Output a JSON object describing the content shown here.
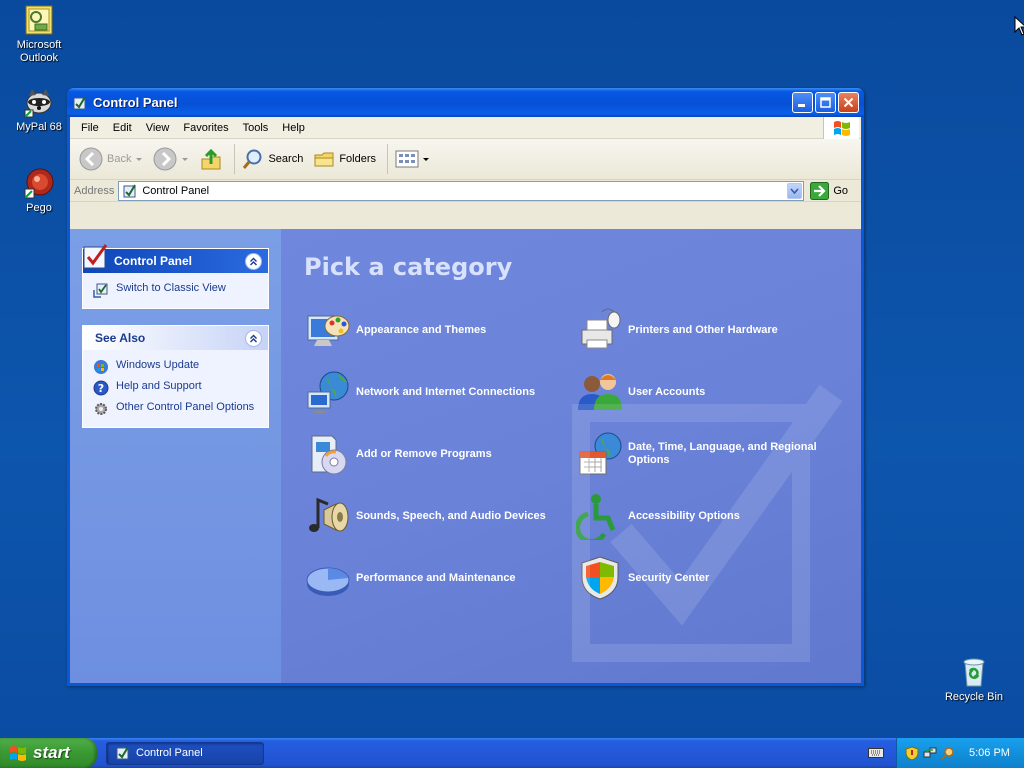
{
  "desktop": {
    "icons": [
      {
        "label_line1": "Microsoft",
        "label_line2": "Outlook"
      },
      {
        "label_line1": "MyPal 68",
        "label_line2": ""
      },
      {
        "label_line1": "Pego",
        "label_line2": ""
      },
      {
        "label_line1": "Recycle Bin",
        "label_line2": ""
      }
    ]
  },
  "window": {
    "title": "Control Panel",
    "menu": [
      "File",
      "Edit",
      "View",
      "Favorites",
      "Tools",
      "Help"
    ],
    "toolbar": {
      "back": "Back",
      "search": "Search",
      "folders": "Folders"
    },
    "address": {
      "label": "Address",
      "value": "Control Panel",
      "go": "Go"
    },
    "taskpane": {
      "control_panel": {
        "title": "Control Panel",
        "links": [
          "Switch to Classic View"
        ]
      },
      "see_also": {
        "title": "See Also",
        "links": [
          "Windows Update",
          "Help and Support",
          "Other Control Panel Options"
        ]
      }
    },
    "main": {
      "heading": "Pick a category",
      "categories": [
        {
          "label": "Appearance and Themes",
          "icon": "appearance-themes-icon"
        },
        {
          "label": "Printers and Other Hardware",
          "icon": "printers-hardware-icon"
        },
        {
          "label": "Network and Internet Connections",
          "icon": "network-internet-icon"
        },
        {
          "label": "User Accounts",
          "icon": "user-accounts-icon"
        },
        {
          "label": "Add or Remove Programs",
          "icon": "add-remove-programs-icon"
        },
        {
          "label": "Date, Time, Language, and Regional Options",
          "icon": "date-time-language-icon"
        },
        {
          "label": "Sounds, Speech, and Audio Devices",
          "icon": "sounds-audio-icon"
        },
        {
          "label": "Accessibility Options",
          "icon": "accessibility-icon"
        },
        {
          "label": "Performance and Maintenance",
          "icon": "performance-maintenance-icon"
        },
        {
          "label": "Security Center",
          "icon": "security-center-icon"
        }
      ]
    }
  },
  "taskbar": {
    "start_label": "start",
    "task_item": "Control Panel",
    "clock": "5:06 PM"
  },
  "colors": {
    "desktop": "#0b4ea2",
    "title_bar": "#0650d6",
    "task_pane": "#7b9fe6",
    "content": "#6f87dc",
    "start_button": "#3c9a35",
    "tray": "#1290dc"
  }
}
